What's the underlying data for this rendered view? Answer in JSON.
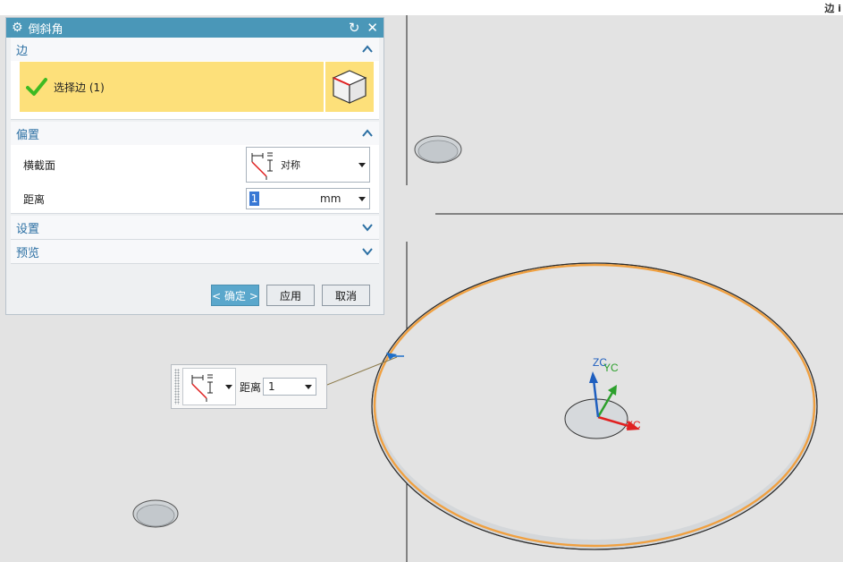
{
  "corner_text": "边 i",
  "dialog": {
    "title": "倒斜角",
    "groups": {
      "edge": {
        "label": "边",
        "selection_label": "选择边 (1)"
      },
      "offset": {
        "label": "偏置",
        "cross_section": {
          "label": "横截面",
          "value": "对称"
        },
        "distance": {
          "label": "距离",
          "value": "1",
          "unit": "mm"
        }
      },
      "settings": {
        "label": "设置"
      },
      "preview": {
        "label": "预览"
      }
    },
    "buttons": {
      "ok": "< 确定 >",
      "apply": "应用",
      "cancel": "取消"
    }
  },
  "float_handle": {
    "distance_label": "距离",
    "distance_value": "1"
  },
  "triad": {
    "zc": "ZC",
    "yc": "YC",
    "xc": "XC"
  },
  "colors": {
    "titlebar": "#4a97b8",
    "selection_highlight": "#fde07a",
    "check": "#3dba22",
    "edge_highlight": "#f0a040",
    "axis_x": "#e02020",
    "axis_y": "#2ca02c",
    "axis_z": "#1f5fbf"
  },
  "icons": [
    "settings-gear-icon",
    "reset-icon",
    "close-icon",
    "checkmark-icon",
    "cube-icon",
    "chevron-up-icon",
    "chevron-down-icon",
    "symmetric-section-icon",
    "dropdown-arrow-icon",
    "grip-icon"
  ]
}
